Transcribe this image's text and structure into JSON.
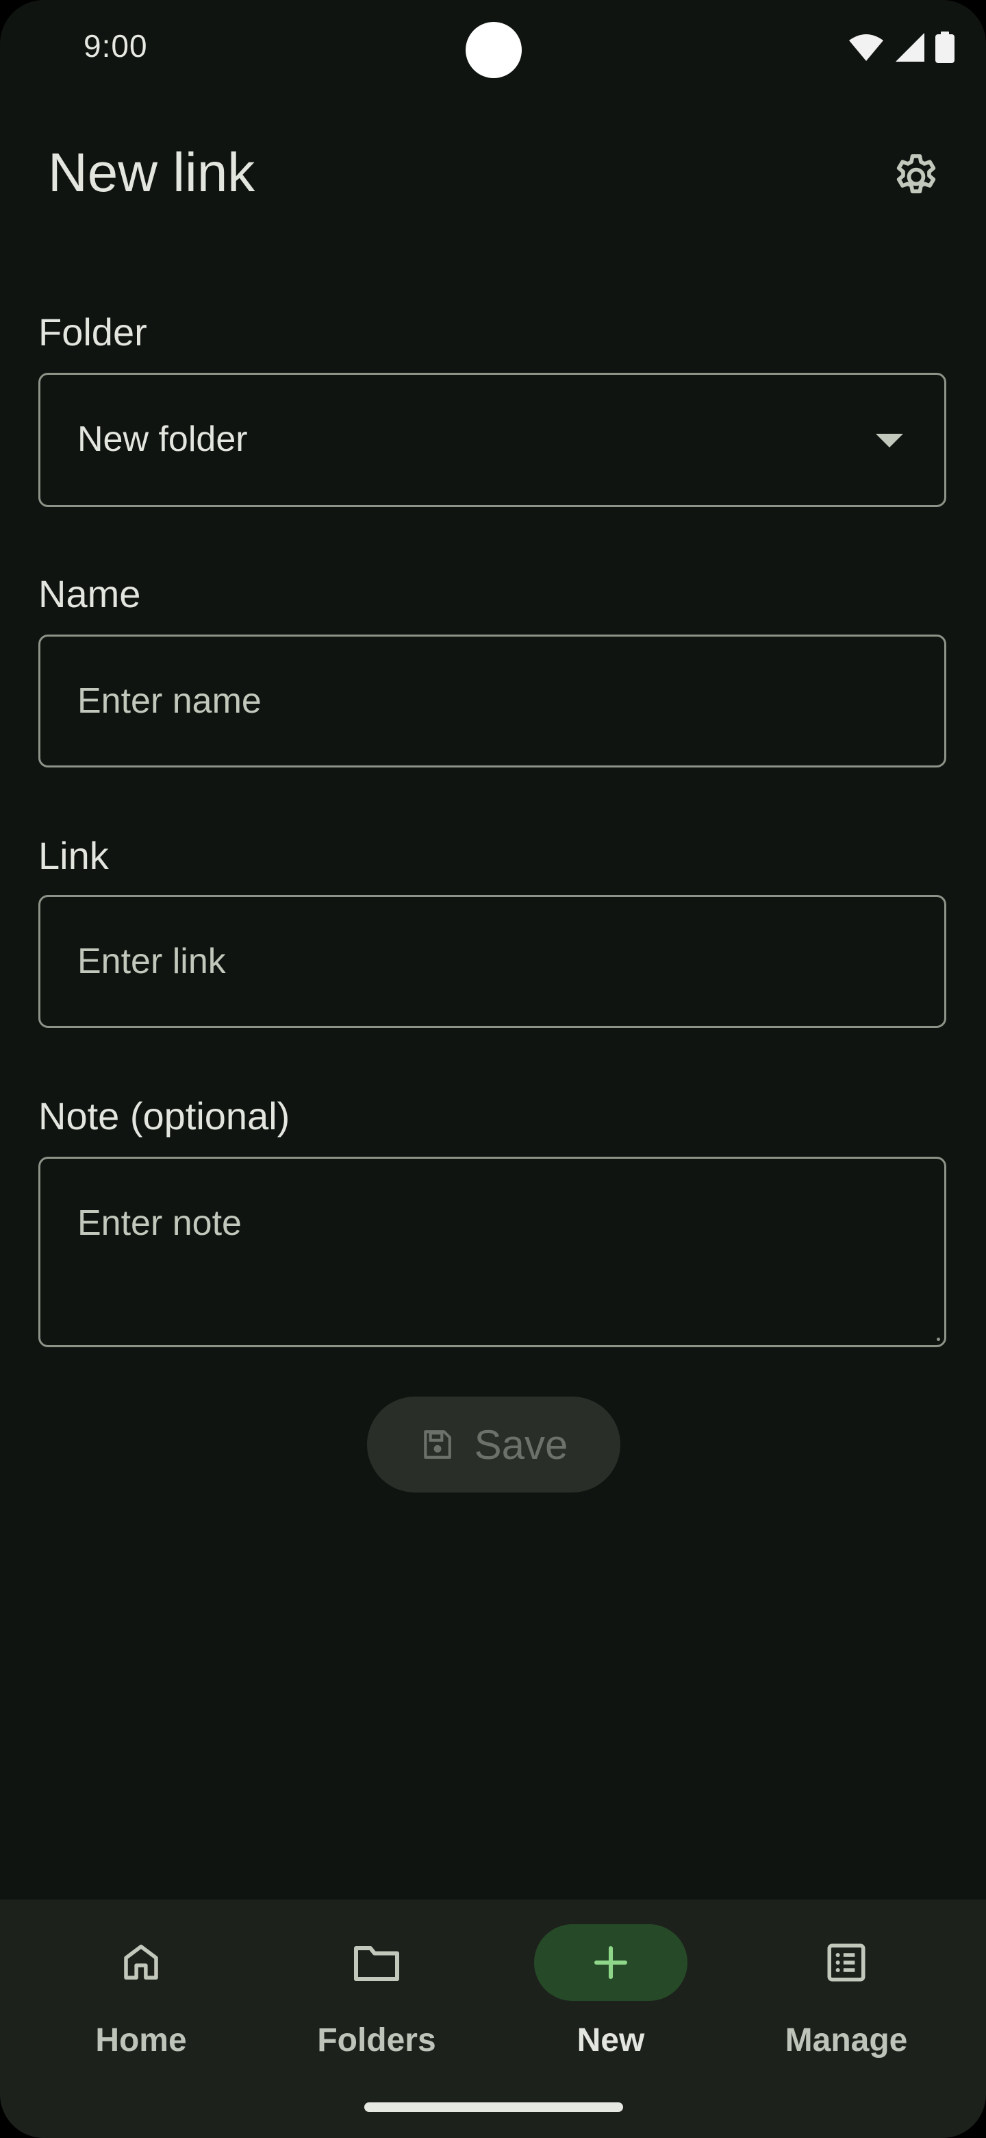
{
  "status_bar": {
    "time": "9:00"
  },
  "app_bar": {
    "title": "New link",
    "settings_icon": "gear-icon"
  },
  "form": {
    "folder": {
      "label": "Folder",
      "selected_value": "New folder"
    },
    "name": {
      "label": "Name",
      "placeholder": "Enter name"
    },
    "link": {
      "label": "Link",
      "placeholder": "Enter link"
    },
    "note": {
      "label": "Note (optional)",
      "placeholder": "Enter note"
    },
    "save_button": {
      "label": "Save",
      "icon": "floppy-disk-icon",
      "enabled": false
    }
  },
  "bottom_nav": {
    "items": [
      {
        "label": "Home",
        "icon": "home-icon",
        "active": false
      },
      {
        "label": "Folders",
        "icon": "folder-icon",
        "active": false
      },
      {
        "label": "New",
        "icon": "plus-icon",
        "active": true
      },
      {
        "label": "Manage",
        "icon": "list-icon",
        "active": false
      }
    ]
  },
  "colors": {
    "background": "#101410",
    "surface": "#1d211c",
    "accent_active": "#264a27",
    "accent_icon": "#8fd58a",
    "outline": "#8d9388",
    "text_primary": "#e3e5df",
    "text_secondary": "#c3c8bc"
  }
}
